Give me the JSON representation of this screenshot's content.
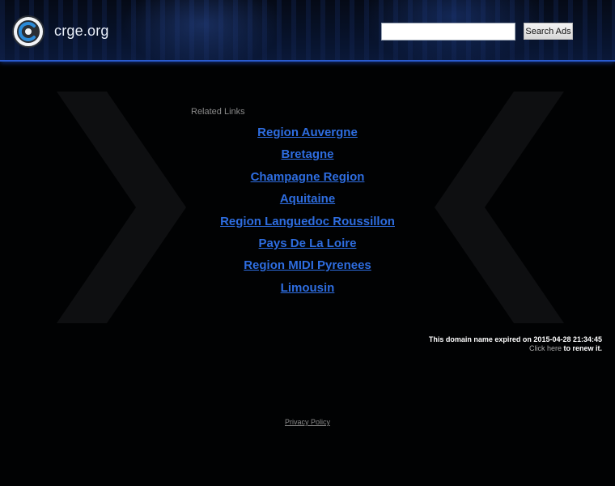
{
  "header": {
    "site_name": "crge.org",
    "search": {
      "value": "",
      "placeholder": "",
      "button_label": "Search Ads"
    }
  },
  "main": {
    "related_title": "Related Links",
    "links": [
      "Region Auvergne",
      "Bretagne",
      "Champagne Region",
      "Aquitaine",
      "Region Languedoc Roussillon",
      "Pays De La Loire",
      "Region MIDI Pyrenees",
      "Limousin"
    ]
  },
  "notice": {
    "expired_text": "This domain name expired on 2015-04-28 21:34:45",
    "renew_link": "Click here",
    "renew_suffix": " to renew it."
  },
  "footer": {
    "privacy_label": "Privacy Policy"
  },
  "colors": {
    "accent": "#2e6de0",
    "header_border": "#2a5bd0",
    "background": "#010203"
  }
}
